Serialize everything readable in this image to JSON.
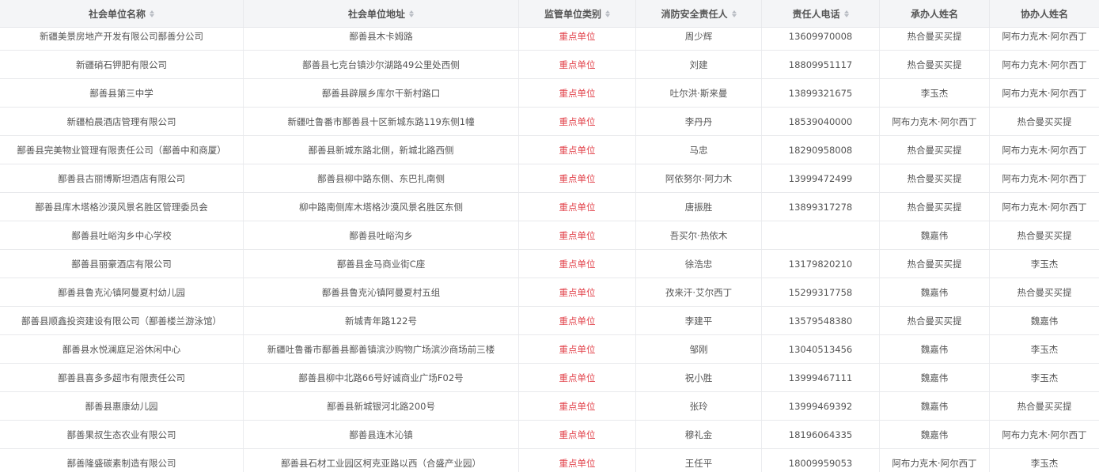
{
  "columns": [
    "社会单位名称",
    "社会单位地址",
    "监管单位类别",
    "消防安全责任人",
    "责任人电话",
    "承办人姓名",
    "协办人姓名"
  ],
  "colors": {
    "category_red": "#e2434b",
    "header_bg": "#f4f5f7"
  },
  "rows": [
    [
      "新疆美景房地产开发有限公司鄯善分公司",
      "鄯善县木卡姆路",
      "重点单位",
      "周少辉",
      "13609970008",
      "热合曼买买提",
      "阿布力克木·阿尔西丁"
    ],
    [
      "新疆硝石钾肥有限公司",
      "鄯善县七克台镇沙尔湖路49公里处西侧",
      "重点单位",
      "刘建",
      "18809951117",
      "热合曼买买提",
      "阿布力克木·阿尔西丁"
    ],
    [
      "鄯善县第三中学",
      "鄯善县辟展乡库尔干新村路口",
      "重点单位",
      "吐尔洪·斯来曼",
      "13899321675",
      "李玉杰",
      "阿布力克木·阿尔西丁"
    ],
    [
      "新疆柏晨酒店管理有限公司",
      "新疆吐鲁番市鄯善县十区新城东路119东侧1幢",
      "重点单位",
      "李丹丹",
      "18539040000",
      "阿布力克木·阿尔西丁",
      "热合曼买买提"
    ],
    [
      "鄯善县完美物业管理有限责任公司（鄯善中和商厦）",
      "鄯善县新城东路北侧，新城北路西侧",
      "重点单位",
      "马忠",
      "18290958008",
      "热合曼买买提",
      "阿布力克木·阿尔西丁"
    ],
    [
      "鄯善县古丽博斯坦酒店有限公司",
      "鄯善县柳中路东侧、东巴扎南侧",
      "重点单位",
      "阿依努尔·阿力木",
      "13999472499",
      "热合曼买买提",
      "阿布力克木·阿尔西丁"
    ],
    [
      "鄯善县库木塔格沙漠风景名胜区管理委员会",
      "柳中路南侧库木塔格沙漠风景名胜区东侧",
      "重点单位",
      "唐振胜",
      "13899317278",
      "热合曼买买提",
      "阿布力克木·阿尔西丁"
    ],
    [
      "鄯善县吐峪沟乡中心学校",
      "鄯善县吐峪沟乡",
      "重点单位",
      "吾买尔·热依木",
      "",
      "魏嘉伟",
      "热合曼买买提"
    ],
    [
      "鄯善县丽豪酒店有限公司",
      "鄯善县金马商业街C座",
      "重点单位",
      "徐浩忠",
      "13179820210",
      "热合曼买买提",
      "李玉杰"
    ],
    [
      "鄯善县鲁克沁镇阿曼夏村幼儿园",
      "鄯善县鲁克沁镇阿曼夏村五组",
      "重点单位",
      "孜来汗·艾尔西丁",
      "15299317758",
      "魏嘉伟",
      "热合曼买买提"
    ],
    [
      "鄯善县顺鑫投资建设有限公司（鄯善楼兰游泳馆）",
      "新城青年路122号",
      "重点单位",
      "李建平",
      "13579548380",
      "热合曼买买提",
      "魏嘉伟"
    ],
    [
      "鄯善县水悦澜庭足浴休闲中心",
      "新疆吐鲁番市鄯善县鄯善镇滨沙购物广场滨沙商场前三楼",
      "重点单位",
      "邹刚",
      "13040513456",
      "魏嘉伟",
      "李玉杰"
    ],
    [
      "鄯善县喜多多超市有限责任公司",
      "鄯善县柳中北路66号好诚商业广场F02号",
      "重点单位",
      "祝小胜",
      "13999467111",
      "魏嘉伟",
      "李玉杰"
    ],
    [
      "鄯善县惠康幼儿园",
      "鄯善县新城银河北路200号",
      "重点单位",
      "张玲",
      "13999469392",
      "魏嘉伟",
      "热合曼买买提"
    ],
    [
      "鄯善果叔生态农业有限公司",
      "鄯善县连木沁镇",
      "重点单位",
      "穆礼金",
      "18196064335",
      "魏嘉伟",
      "阿布力克木·阿尔西丁"
    ],
    [
      "鄯善隆盛碳素制造有限公司",
      "鄯善县石材工业园区柯克亚路以西（合盛产业园）",
      "重点单位",
      "王任平",
      "18009959053",
      "阿布力克木·阿尔西丁",
      "李玉杰"
    ]
  ]
}
